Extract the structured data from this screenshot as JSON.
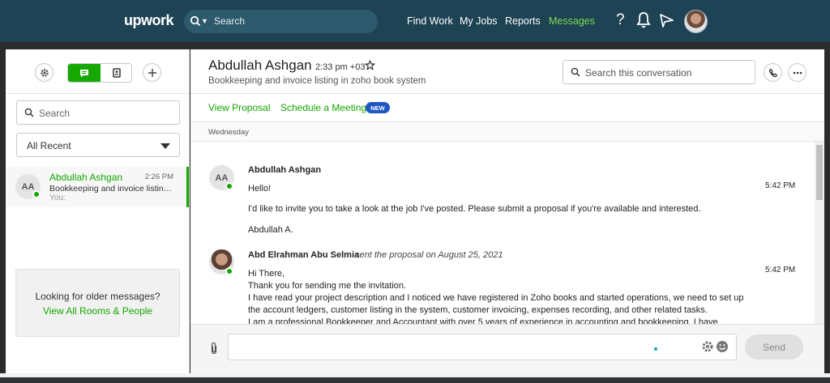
{
  "topnav": {
    "logo": "upwork",
    "search_placeholder": "Search",
    "links": [
      "Find Work",
      "My Jobs",
      "Reports",
      "Messages"
    ],
    "active_link": "Messages",
    "help_label": "?"
  },
  "sidebar": {
    "search_placeholder": "Search",
    "filter_value": "All Recent",
    "rooms": [
      {
        "initials": "AA",
        "name": "Abdullah Ashgan",
        "time": "2:26 PM",
        "snippet": "Bookkeeping and invoice listing i...",
        "sender": "You:"
      }
    ],
    "older_prompt": "Looking for older messages?",
    "older_link": "View All Rooms & People"
  },
  "room": {
    "name": "Abdullah Ashgan",
    "local_time": "2:33 pm +03",
    "subtitle": "Bookkeeping and invoice listing in zoho book system",
    "search_placeholder": "Search this conversation",
    "actions": [
      "View Proposal",
      "Schedule a Meeting"
    ],
    "new_badge": "NEW",
    "day_label": "Wednesday"
  },
  "messages": [
    {
      "initials": "AA",
      "author": "Abdullah Ashgan",
      "meta": "",
      "time": "5:42 PM",
      "lines": [
        "Hello!",
        "I'd like to invite you to take a look at the job I've posted. Please submit a proposal if you're available and interested.",
        "Abdullah A."
      ]
    },
    {
      "initials": "",
      "author": "Abd Elrahman Abu Selmia",
      "meta": "sent the proposal on August 25, 2021",
      "time": "5:42 PM",
      "lines": [
        "Hi There,",
        "Thank you for sending me the invitation.",
        "I have read your project description and I noticed we have registered in Zoho books and started operations, we need to set up",
        "the account ledgers, customer listing in the system, customer invoicing, expenses recording, and other related tasks.",
        "I am a professional Bookkeeper and Accountant with over 5 years of experience in accounting and bookkeeping. I have"
      ]
    }
  ],
  "composer": {
    "send_label": "Send"
  },
  "colors": {
    "nav_bg": "#1d4354",
    "accent_green": "#14a800",
    "badge_blue": "#1f57c3"
  }
}
